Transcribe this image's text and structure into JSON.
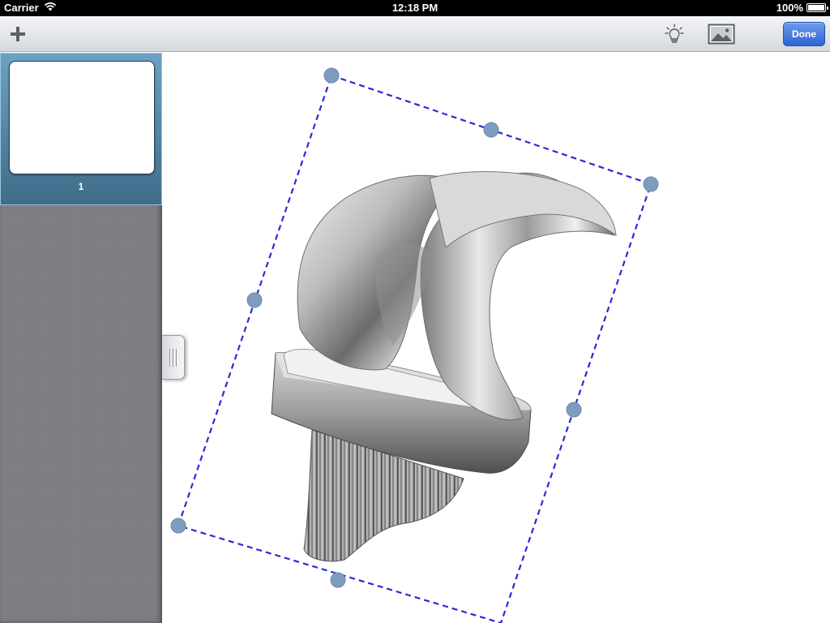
{
  "status_bar": {
    "carrier": "Carrier",
    "time": "12:18 PM",
    "battery": "100%",
    "battery_level": 1.0
  },
  "toolbar": {
    "add_icon": "plus-icon",
    "bulb_icon": "lightbulb-icon",
    "image_icon": "image-icon",
    "done_label": "Done",
    "done_color": "#2c63d6"
  },
  "sidebar": {
    "pages": [
      {
        "number": "1",
        "selected": true
      }
    ],
    "selected_color": "#4f84a6"
  },
  "canvas": {
    "selected_object": "knee-implant-image",
    "selection_color": "#2b2bd1",
    "handle_color": "#7f9cc0"
  }
}
